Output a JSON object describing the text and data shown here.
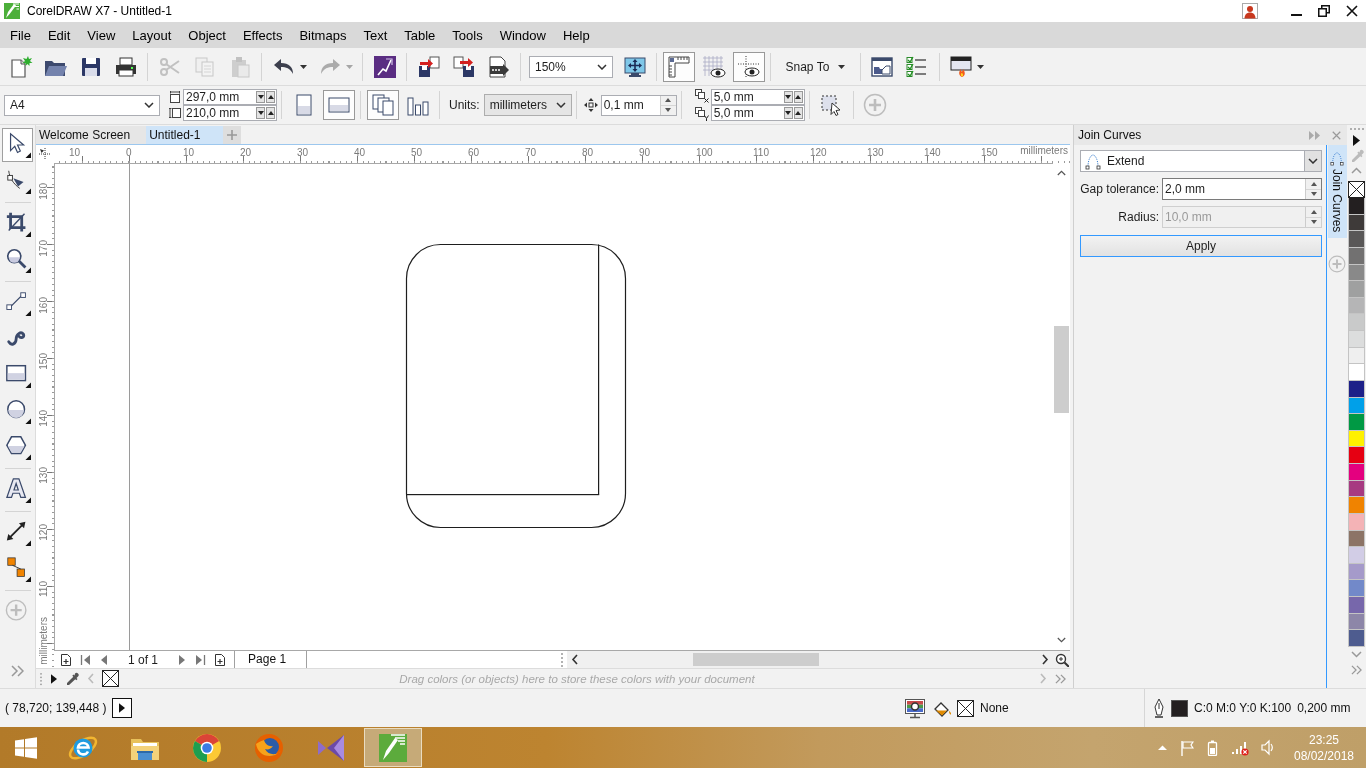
{
  "window": {
    "title": "CorelDRAW X7 - Untitled-1"
  },
  "menu": [
    "File",
    "Edit",
    "View",
    "Layout",
    "Object",
    "Effects",
    "Bitmaps",
    "Text",
    "Table",
    "Tools",
    "Window",
    "Help"
  ],
  "standard_toolbar": [
    [
      {
        "kind": "new",
        "disabled": false
      },
      {
        "kind": "open",
        "disabled": false
      },
      {
        "kind": "save",
        "disabled": false
      },
      {
        "kind": "print",
        "disabled": false
      }
    ],
    [
      {
        "kind": "cut",
        "disabled": true
      },
      {
        "kind": "copy",
        "disabled": true
      },
      {
        "kind": "paste",
        "disabled": true
      }
    ],
    [
      {
        "kind": "undo",
        "disabled": false
      },
      {
        "kind": "redo",
        "disabled": true
      }
    ],
    [
      {
        "kind": "launcher",
        "disabled": false
      }
    ],
    [
      {
        "kind": "import",
        "disabled": false
      },
      {
        "kind": "export",
        "disabled": false
      },
      {
        "kind": "publish_pdf",
        "disabled": false
      }
    ],
    [
      {
        "kind": "zoom_level",
        "value": "150%"
      },
      {
        "kind": "zoom_page",
        "disabled": false
      }
    ],
    [
      {
        "kind": "rulers",
        "on": true
      },
      {
        "kind": "grid",
        "on": false
      },
      {
        "kind": "guidelines",
        "on": true
      }
    ],
    [
      {
        "kind": "snap",
        "label": "Snap To"
      }
    ],
    [
      {
        "kind": "options",
        "disabled": false
      },
      {
        "kind": "checklist",
        "disabled": false
      }
    ],
    [
      {
        "kind": "color_proof",
        "disabled": false
      }
    ]
  ],
  "property_bar": {
    "page_size": "A4",
    "page_width": "297,0 mm",
    "page_height": "210,0 mm",
    "orientation": [
      {
        "kind": "portrait",
        "selected": false
      },
      {
        "kind": "landscape",
        "selected": true
      }
    ],
    "page_scope": [
      {
        "kind": "all_pages",
        "selected": true
      },
      {
        "kind": "current_page",
        "selected": false
      }
    ],
    "units_label": "Units:",
    "units": "millimeters",
    "nudge": "0,1 mm",
    "duplicate_x": "5,0 mm",
    "duplicate_y": "5,0 mm"
  },
  "toolbox": [
    [
      {
        "kind": "pick",
        "selected": true,
        "flyout": true
      },
      {
        "kind": "shape",
        "selected": false,
        "flyout": true
      }
    ],
    [
      {
        "kind": "crop",
        "selected": false,
        "flyout": true
      },
      {
        "kind": "zoom",
        "selected": false,
        "flyout": true
      }
    ],
    [
      {
        "kind": "freehand",
        "selected": false,
        "flyout": true
      },
      {
        "kind": "artistic",
        "selected": false,
        "flyout": false
      },
      {
        "kind": "rectangle",
        "selected": false,
        "flyout": true
      },
      {
        "kind": "ellipse",
        "selected": false,
        "flyout": true
      },
      {
        "kind": "polygon",
        "selected": false,
        "flyout": true
      }
    ],
    [
      {
        "kind": "text",
        "selected": false,
        "flyout": true
      }
    ],
    [
      {
        "kind": "dimension",
        "selected": false,
        "flyout": true
      },
      {
        "kind": "connector",
        "selected": false,
        "flyout": true
      }
    ],
    [
      {
        "kind": "add",
        "selected": false,
        "flyout": false
      }
    ]
  ],
  "document_tabs": [
    {
      "label": "Welcome Screen",
      "selected": false
    },
    {
      "label": "Untitled-1",
      "selected": true
    }
  ],
  "horizontal_ruler": {
    "labels": [
      "10",
      "0",
      "10",
      "20",
      "30",
      "40",
      "50",
      "60",
      "70",
      "80",
      "90",
      "100",
      "110",
      "120",
      "130",
      "140",
      "150"
    ],
    "unit": "millimeters"
  },
  "vertical_ruler": {
    "labels": [
      "180",
      "170",
      "160",
      "150",
      "140",
      "130",
      "120",
      "110"
    ],
    "unit": "millimeters"
  },
  "page_navigator": {
    "counter": "1 of 1",
    "pages": [
      {
        "label": "Page 1",
        "selected": true
      }
    ]
  },
  "document_palette": {
    "hint": "Drag colors (or objects) here to store these colors with your document"
  },
  "docker": {
    "title": "Join Curves",
    "mode": "Extend",
    "fields": [
      {
        "label": "Gap tolerance:",
        "value": "2,0 mm",
        "disabled": false
      },
      {
        "label": "Radius:",
        "value": "10,0 mm",
        "disabled": true
      }
    ],
    "button": "Apply"
  },
  "docker_tabs": [
    {
      "label": "Join Curves",
      "selected": true
    }
  ],
  "color_palette": [
    {
      "color": "#231f20"
    },
    {
      "color": "#3e3a39"
    },
    {
      "color": "#595757"
    },
    {
      "color": "#727171"
    },
    {
      "color": "#898989"
    },
    {
      "color": "#9fa0a0"
    },
    {
      "color": "#b5b5b6"
    },
    {
      "color": "#c9caca"
    },
    {
      "color": "#dcdddd"
    },
    {
      "color": "#efefef"
    },
    {
      "color": "#ffffff"
    },
    {
      "color": "#1d2088"
    },
    {
      "color": "#00a0e9"
    },
    {
      "color": "#009944"
    },
    {
      "color": "#fff100"
    },
    {
      "color": "#e60012"
    },
    {
      "color": "#e4007f"
    },
    {
      "color": "#a73a81"
    },
    {
      "color": "#f08300"
    },
    {
      "color": "#f4b3b6"
    },
    {
      "color": "#8c7466"
    },
    {
      "color": "#d2cde6"
    },
    {
      "color": "#a59aca"
    },
    {
      "color": "#7289c9"
    },
    {
      "color": "#7767ab"
    },
    {
      "color": "#8d86a8"
    },
    {
      "color": "#4e5c8f"
    }
  ],
  "status_bar": {
    "coordinates": "( 78,720; 139,448 )",
    "fill": "None",
    "outline_color": "C:0 M:0 Y:0 K:100",
    "outline_width": "0,200 mm"
  },
  "taskbar": {
    "apps": [
      {
        "kind": "internet_explorer",
        "active": false
      },
      {
        "kind": "file_explorer",
        "active": false
      },
      {
        "kind": "chrome",
        "active": false
      },
      {
        "kind": "firefox",
        "active": false
      },
      {
        "kind": "visual_studio",
        "active": false
      },
      {
        "kind": "coreldraw",
        "active": true
      }
    ],
    "time": "23:25",
    "date": "08/02/2018"
  }
}
